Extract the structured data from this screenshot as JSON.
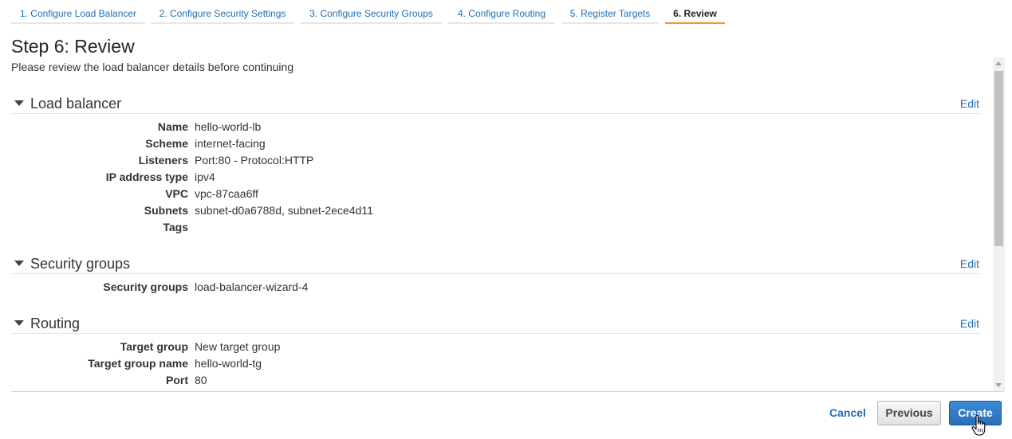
{
  "wizard": {
    "steps": [
      {
        "label": "1. Configure Load Balancer"
      },
      {
        "label": "2. Configure Security Settings"
      },
      {
        "label": "3. Configure Security Groups"
      },
      {
        "label": "4. Configure Routing"
      },
      {
        "label": "5. Register Targets"
      },
      {
        "label": "6. Review"
      }
    ],
    "active_step": 6
  },
  "page": {
    "title": "Step 6: Review",
    "subtitle": "Please review the load balancer details before continuing"
  },
  "sections": {
    "load_balancer": {
      "title": "Load balancer",
      "edit_label": "Edit",
      "rows": [
        {
          "key": "Name",
          "value": "hello-world-lb"
        },
        {
          "key": "Scheme",
          "value": "internet-facing"
        },
        {
          "key": "Listeners",
          "value": "Port:80 - Protocol:HTTP"
        },
        {
          "key": "IP address type",
          "value": "ipv4"
        },
        {
          "key": "VPC",
          "value": "vpc-87caa6ff"
        },
        {
          "key": "Subnets",
          "value": "subnet-d0a6788d, subnet-2ece4d11"
        },
        {
          "key": "Tags",
          "value": ""
        }
      ]
    },
    "security_groups": {
      "title": "Security groups",
      "edit_label": "Edit",
      "rows": [
        {
          "key": "Security groups",
          "value": "load-balancer-wizard-4"
        }
      ]
    },
    "routing": {
      "title": "Routing",
      "edit_label": "Edit",
      "rows": [
        {
          "key": "Target group",
          "value": "New target group"
        },
        {
          "key": "Target group name",
          "value": "hello-world-tg"
        },
        {
          "key": "Port",
          "value": "80"
        }
      ]
    }
  },
  "footer": {
    "cancel_label": "Cancel",
    "previous_label": "Previous",
    "create_label": "Create"
  },
  "colors": {
    "link": "#1f6fb2",
    "active_tab_underline": "#ec9a2c",
    "primary_button": "#2a6fb8"
  }
}
